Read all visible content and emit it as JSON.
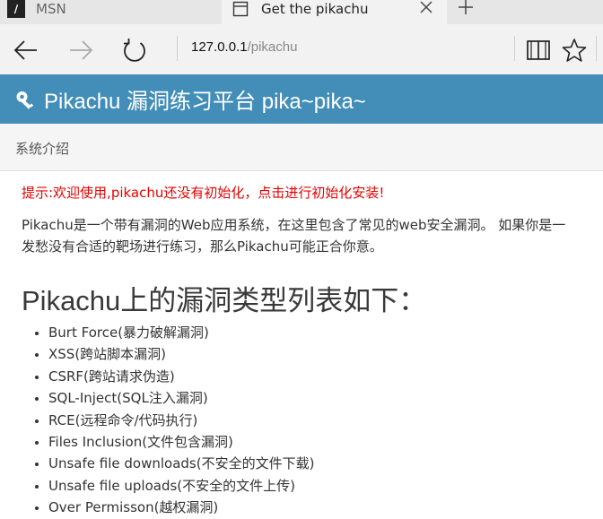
{
  "browser": {
    "tabs": [
      {
        "label": "MSN",
        "favicon": "msn-favicon"
      },
      {
        "label": "Get the pikachu",
        "favicon": "page-icon"
      }
    ],
    "url_host": "127.0.0.1",
    "url_path": "/pikachu"
  },
  "header": {
    "brand": "Pikachu 漏洞练习平台 pika~pika~"
  },
  "subnav": {
    "breadcrumb": "系统介绍"
  },
  "main": {
    "notice": "提示:欢迎使用,pikachu还没有初始化，点击进行初始化安装!",
    "intro_line1": "Pikachu是一个带有漏洞的Web应用系统，在这里包含了常见的web安全漏洞。 如果你是一",
    "intro_line2": "发愁没有合适的靶场进行练习，那么Pikachu可能正合你意。",
    "list_title": "Pikachu上的漏洞类型列表如下：",
    "vulns": [
      "Burt Force(暴力破解漏洞)",
      "XSS(跨站脚本漏洞)",
      "CSRF(跨站请求伪造)",
      "SQL-Inject(SQL注入漏洞)",
      "RCE(远程命令/代码执行)",
      "Files Inclusion(文件包含漏洞)",
      "Unsafe file downloads(不安全的文件下载)",
      "Unsafe file uploads(不安全的文件上传)",
      "Over Permisson(越权漏洞)"
    ]
  },
  "colors": {
    "header_bg": "#438eb9",
    "notice": "#e60000"
  }
}
